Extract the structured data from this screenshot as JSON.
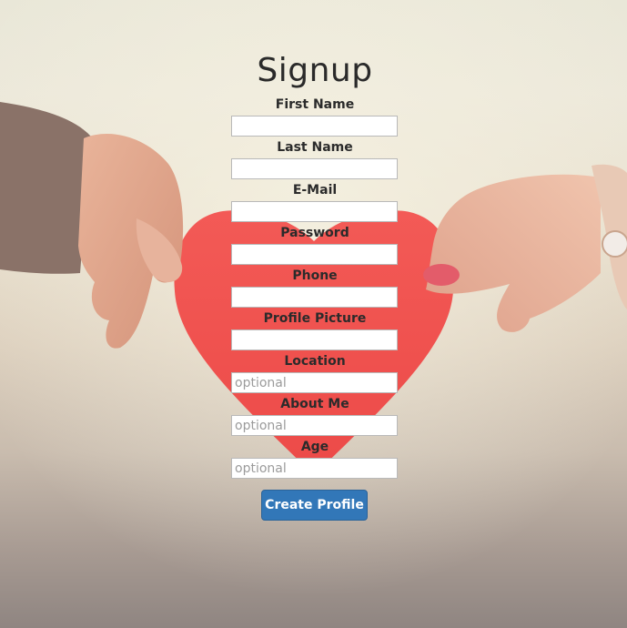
{
  "form": {
    "title": "Signup",
    "fields": [
      {
        "label": "First Name",
        "value": "",
        "placeholder": ""
      },
      {
        "label": "Last Name",
        "value": "",
        "placeholder": ""
      },
      {
        "label": "E-Mail",
        "value": "",
        "placeholder": ""
      },
      {
        "label": "Password",
        "value": "",
        "placeholder": ""
      },
      {
        "label": "Phone",
        "value": "",
        "placeholder": ""
      },
      {
        "label": "Profile Picture",
        "value": "",
        "placeholder": ""
      },
      {
        "label": "Location",
        "value": "",
        "placeholder": "optional"
      },
      {
        "label": "About Me",
        "value": "",
        "placeholder": "optional"
      },
      {
        "label": "Age",
        "value": "",
        "placeholder": "optional"
      }
    ],
    "submit_label": "Create Profile"
  },
  "colors": {
    "heart": "#f0504e",
    "button": "#3277b8",
    "title_text": "#2a2a2a"
  },
  "background": {
    "image_subject": "two hands holding a red paper heart"
  }
}
